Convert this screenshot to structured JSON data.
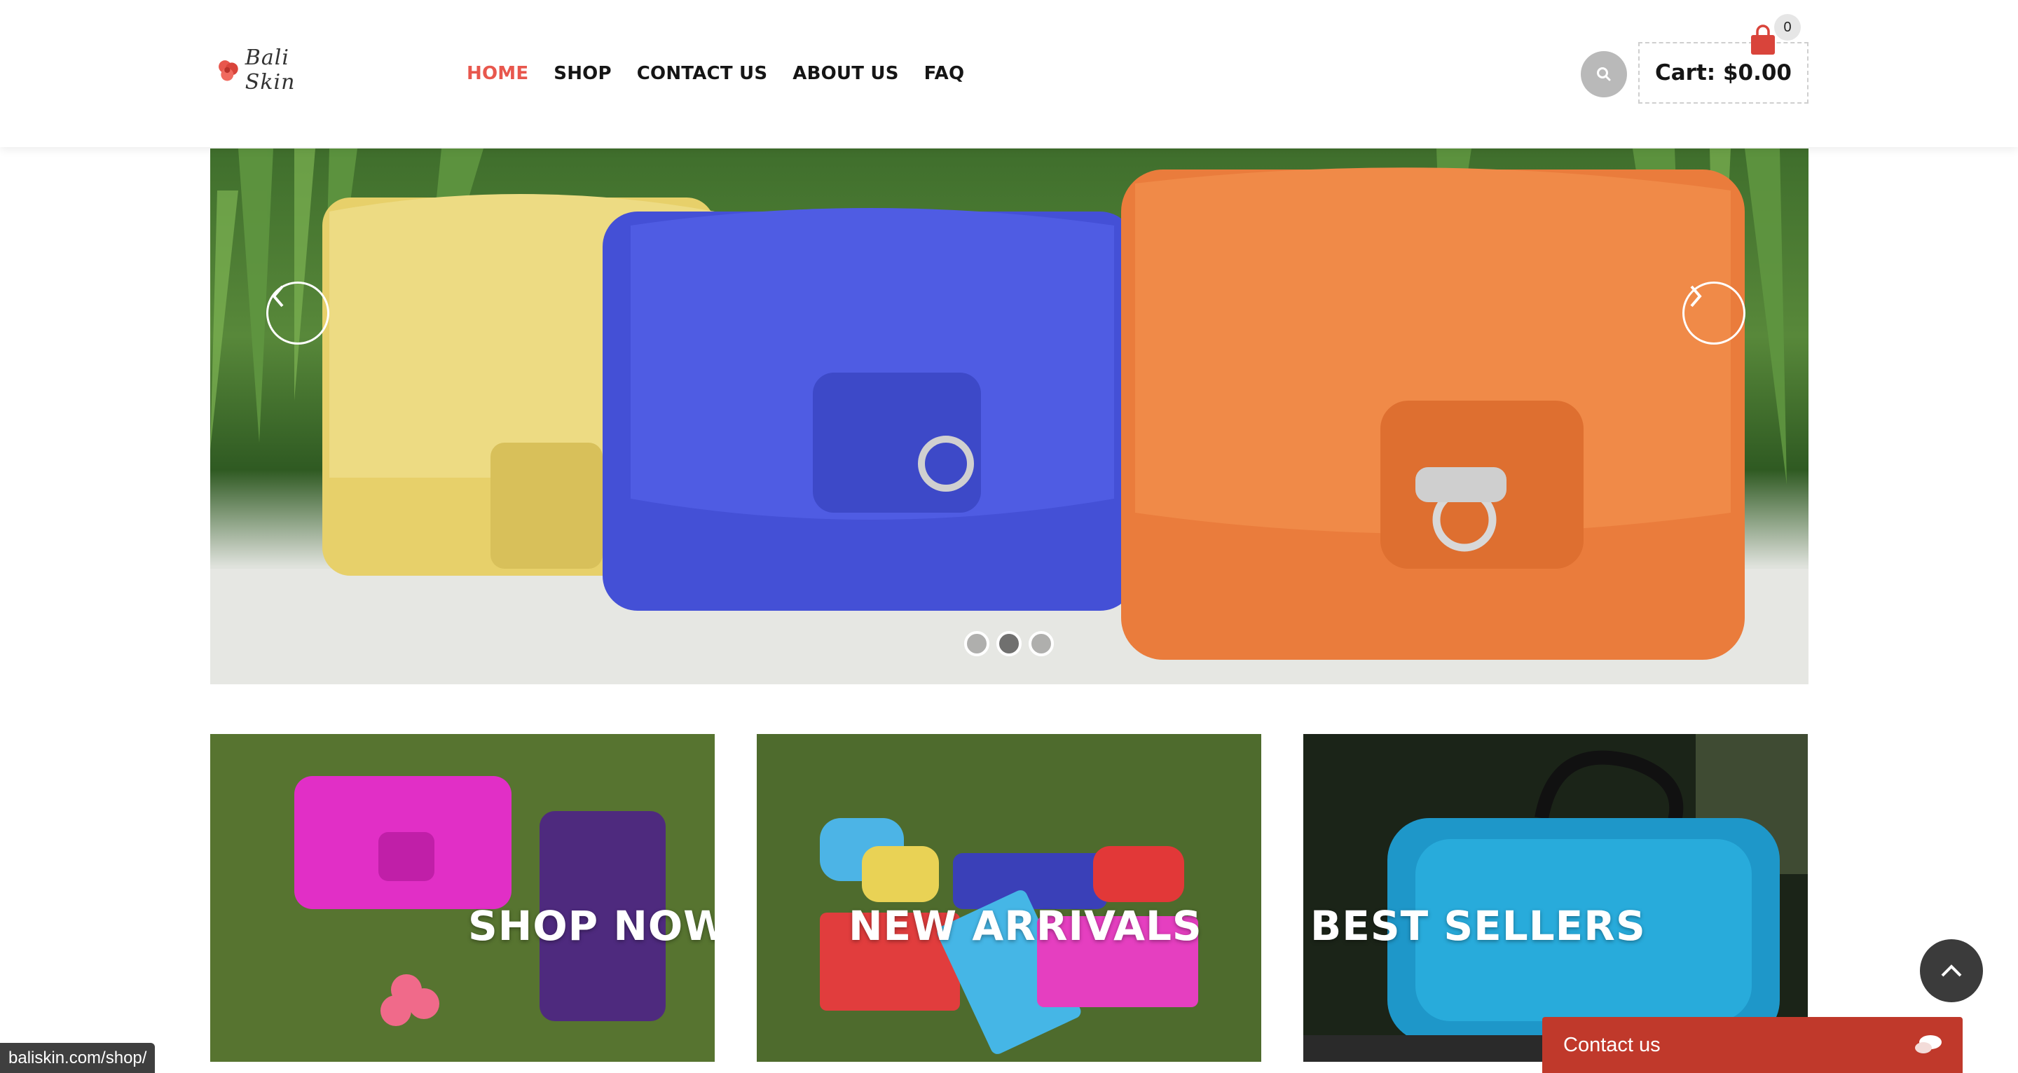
{
  "header": {
    "logo_text": "Bali Skin",
    "nav": [
      {
        "label": "HOME",
        "active": true
      },
      {
        "label": "SHOP",
        "active": false
      },
      {
        "label": "CONTACT US",
        "active": false
      },
      {
        "label": "ABOUT US",
        "active": false
      },
      {
        "label": "FAQ",
        "active": false
      }
    ],
    "cart_label": "Cart: $0.00",
    "cart_count": "0"
  },
  "hero": {
    "slides": 3,
    "active_slide": 2,
    "bags": [
      "yellow",
      "blue",
      "orange"
    ]
  },
  "tiles": [
    {
      "label": "SHOP NOW"
    },
    {
      "label": "NEW ARRIVALS"
    },
    {
      "label": "BEST SELLERS"
    }
  ],
  "widgets": {
    "contact_label": "Contact us",
    "status_url": "baliskin.com/shop/"
  },
  "colors": {
    "accent": "#e8574d",
    "contact_bar": "#c0392b",
    "search_button": "#b9b9b9",
    "back_to_top": "#3b3b3b"
  },
  "icons": [
    "logo-flower-icon",
    "search-icon",
    "cart-bag-icon",
    "chevron-left-icon",
    "chevron-right-icon",
    "chevron-up-icon",
    "chat-bubble-icon"
  ]
}
